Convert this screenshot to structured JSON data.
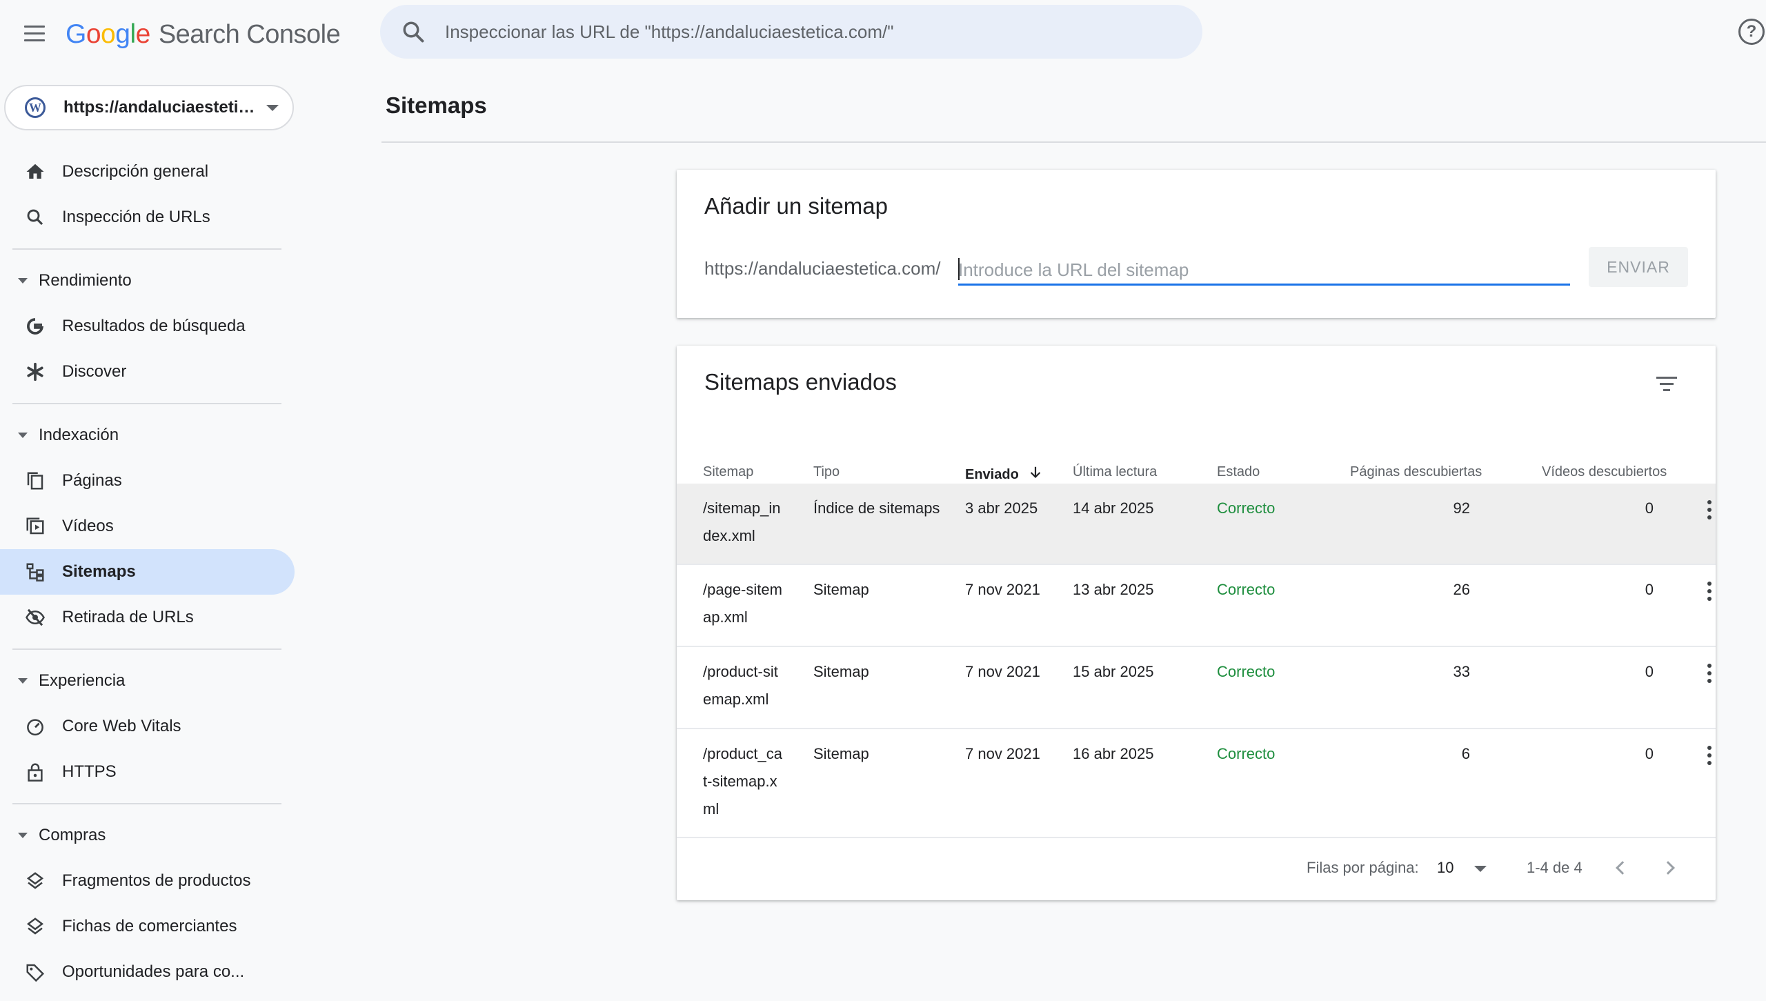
{
  "header": {
    "product_name": "Search Console",
    "search_placeholder": "Inspeccionar las URL de \"https://andaluciaestetica.com/\""
  },
  "property": {
    "label": "https://andaluciaestetica.com/"
  },
  "sidebar": {
    "top_items": [
      {
        "label": "Descripción general",
        "icon": "home-icon"
      },
      {
        "label": "Inspección de URLs",
        "icon": "search-icon"
      }
    ],
    "sections": [
      {
        "label": "Rendimiento",
        "items": [
          {
            "label": "Resultados de búsqueda",
            "icon": "google-g-icon"
          },
          {
            "label": "Discover",
            "icon": "asterisk-icon"
          }
        ]
      },
      {
        "label": "Indexación",
        "items": [
          {
            "label": "Páginas",
            "icon": "pages-icon"
          },
          {
            "label": "Vídeos",
            "icon": "video-icon"
          },
          {
            "label": "Sitemaps",
            "icon": "sitemap-icon",
            "active": true
          },
          {
            "label": "Retirada de URLs",
            "icon": "eye-off-icon"
          }
        ]
      },
      {
        "label": "Experiencia",
        "items": [
          {
            "label": "Core Web Vitals",
            "icon": "gauge-icon"
          },
          {
            "label": "HTTPS",
            "icon": "lock-icon"
          }
        ]
      },
      {
        "label": "Compras",
        "items": [
          {
            "label": "Fragmentos de productos",
            "icon": "layers-icon"
          },
          {
            "label": "Fichas de comerciantes",
            "icon": "layers-icon"
          },
          {
            "label": "Oportunidades para co...",
            "icon": "tag-icon"
          }
        ]
      }
    ]
  },
  "main": {
    "title": "Sitemaps",
    "add_card": {
      "title": "Añadir un sitemap",
      "url_prefix": "https://andaluciaestetica.com/",
      "input_placeholder": "Introduce la URL del sitemap",
      "submit_label": "ENVIAR"
    },
    "list_card": {
      "title": "Sitemaps enviados",
      "columns": [
        "Sitemap",
        "Tipo",
        "Enviado",
        "Última lectura",
        "Estado",
        "Páginas descubiertas",
        "Vídeos descubiertos"
      ],
      "rows": [
        {
          "sitemap": "/sitemap_index.xml",
          "type": "Índice de sitemaps",
          "submitted": "3 abr 2025",
          "last_read": "14 abr 2025",
          "status": "Correcto",
          "pages": "92",
          "videos": "0"
        },
        {
          "sitemap": "/page-sitemap.xml",
          "type": "Sitemap",
          "submitted": "7 nov 2021",
          "last_read": "13 abr 2025",
          "status": "Correcto",
          "pages": "26",
          "videos": "0"
        },
        {
          "sitemap": "/product-sitemap.xml",
          "type": "Sitemap",
          "submitted": "7 nov 2021",
          "last_read": "15 abr 2025",
          "status": "Correcto",
          "pages": "33",
          "videos": "0"
        },
        {
          "sitemap": "/product_cat-sitemap.xml",
          "type": "Sitemap",
          "submitted": "7 nov 2021",
          "last_read": "16 abr 2025",
          "status": "Correcto",
          "pages": "6",
          "videos": "0"
        }
      ],
      "pagination": {
        "rows_per_page_label": "Filas por página:",
        "rows_per_page": "10",
        "range": "1-4 de 4"
      }
    }
  },
  "colors": {
    "accent": "#1a73e8",
    "active_nav": "#d2e3fc",
    "status_ok": "#1e8e3e"
  }
}
